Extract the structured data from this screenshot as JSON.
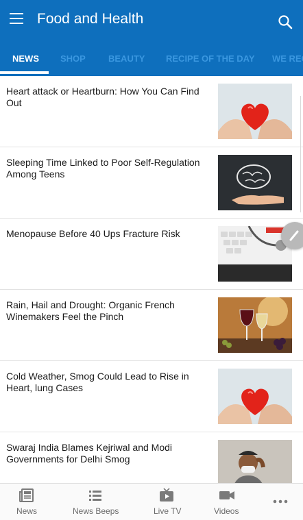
{
  "app": {
    "title": "Food and Health"
  },
  "tabs": [
    "NEWS",
    "SHOP",
    "BEAUTY",
    "RECIPE OF THE DAY",
    "WE REC"
  ],
  "articles": [
    {
      "title": "Heart attack or Heartburn: How You Can Find Out",
      "thumb_icon": "heart-in-hands-image"
    },
    {
      "title": "Sleeping Time Linked to Poor Self-Regulation Among Teens",
      "thumb_icon": "brain-hand-image"
    },
    {
      "title": "Menopause Before 40 Ups Fracture Risk",
      "thumb_icon": "keyboard-stethoscope-image"
    },
    {
      "title": "Rain, Hail and Drought: Organic French Winemakers Feel the Pinch",
      "thumb_icon": "wine-glasses-image"
    },
    {
      "title": "Cold Weather, Smog Could Lead to Rise in Heart, lung Cases",
      "thumb_icon": "heart-in-hands-image"
    },
    {
      "title": "Swaraj India Blames Kejriwal and Modi Governments for Delhi Smog",
      "thumb_icon": "person-mask-smog-image"
    }
  ],
  "bottom_nav": [
    "News",
    "News Beeps",
    "Live TV",
    "Videos"
  ],
  "colors": {
    "primary": "#0e6fbd",
    "tab_inactive": "#3a97e0",
    "heart": "#e2231a"
  }
}
